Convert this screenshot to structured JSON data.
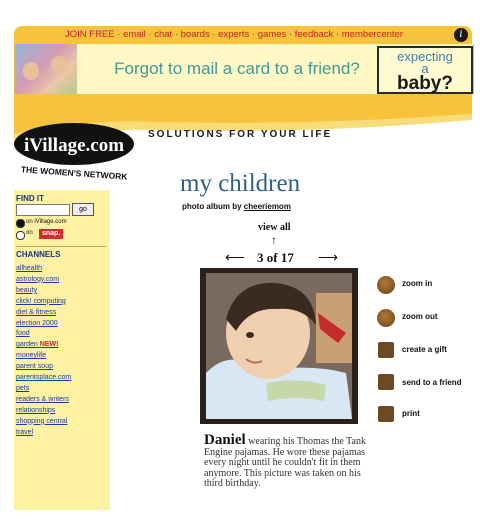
{
  "topnav": {
    "links": [
      "JOIN FREE",
      "email",
      "chat",
      "boards",
      "experts",
      "games",
      "feedback",
      "membercenter"
    ],
    "help_icon": "i"
  },
  "ad": {
    "text": "Forgot to mail a card to a friend?",
    "box_line1": "expecting",
    "box_line2": "a",
    "box_line3": "baby?"
  },
  "header": {
    "logo_text": "iVillage.com",
    "logo_subtext": "THE WOMEN'S NETWORK",
    "tagline": "SOLUTIONS FOR YOUR LIFE"
  },
  "sidebar": {
    "find_heading": "FIND IT",
    "go_label": "go",
    "option1": "on iVillage.com",
    "option2": "on",
    "snap_label": "snap.",
    "channels_heading": "CHANNELS",
    "channels": [
      {
        "label": "allhealth",
        "badge": ""
      },
      {
        "label": "astrology.com",
        "badge": ""
      },
      {
        "label": "beauty",
        "badge": ""
      },
      {
        "label": "click! computing",
        "badge": ""
      },
      {
        "label": "diet & fitness",
        "badge": ""
      },
      {
        "label": "election 2000",
        "badge": ""
      },
      {
        "label": "food",
        "badge": ""
      },
      {
        "label": "garden",
        "badge": "NEW!"
      },
      {
        "label": "moneylife",
        "badge": ""
      },
      {
        "label": "parent soup",
        "badge": ""
      },
      {
        "label": "parentsplace.com",
        "badge": ""
      },
      {
        "label": "pets",
        "badge": ""
      },
      {
        "label": "readers & writers",
        "badge": ""
      },
      {
        "label": "relationships",
        "badge": ""
      },
      {
        "label": "shopping central",
        "badge": ""
      },
      {
        "label": "travel",
        "badge": ""
      }
    ]
  },
  "album": {
    "title": "my children",
    "byline_prefix": "photo album by",
    "owner": "cheeriemom",
    "view_all": "view all",
    "counter": "3 of 17",
    "caption_name": "Daniel",
    "caption_text": " wearing his Thomas the Tank Engine pajamas.  He wore these pajamas every night until he couldn't fit in them anymore.  This picture was taken on his third birthday."
  },
  "actions": {
    "zoom_in": "zoom in",
    "zoom_out": "zoom out",
    "create_gift": "create a gift",
    "send_to_friend": "send to a friend",
    "print": "print"
  },
  "colors": {
    "nav_bar": "#f6c33a",
    "sidebar_bg": "#fdf1a4",
    "title_blue": "#2e5f8a",
    "link_blue": "#1b3d9a",
    "nav_red": "#c0262a"
  }
}
